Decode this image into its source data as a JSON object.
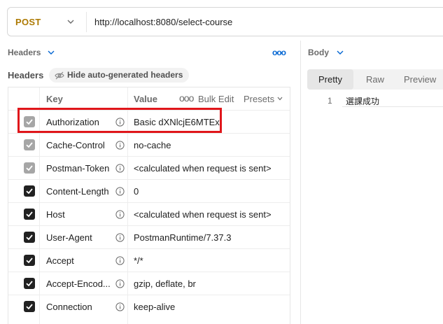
{
  "request": {
    "method": "POST",
    "url": "http://localhost:8080/select-course"
  },
  "left_pane": {
    "section_title": "Headers",
    "more_icon": "ooo",
    "headers_label": "Headers",
    "hide_autogen_label": "Hide auto-generated headers"
  },
  "table": {
    "key_header": "Key",
    "value_header": "Value",
    "more_icon": "ooo",
    "bulk_edit_label": "Bulk Edit",
    "presets_label": "Presets",
    "rows": [
      {
        "key": "Authorization",
        "value": "Basic dXNlcjE6MTEx",
        "checked": true,
        "disabled": true
      },
      {
        "key": "Cache-Control",
        "value": "no-cache",
        "checked": true,
        "disabled": true
      },
      {
        "key": "Postman-Token",
        "value": "<calculated when request is sent>",
        "checked": true,
        "disabled": true
      },
      {
        "key": "Content-Length",
        "value": "0",
        "checked": true,
        "disabled": false
      },
      {
        "key": "Host",
        "value": "<calculated when request is sent>",
        "checked": true,
        "disabled": false
      },
      {
        "key": "User-Agent",
        "value": "PostmanRuntime/7.37.3",
        "checked": true,
        "disabled": false
      },
      {
        "key": "Accept",
        "value": "*/*",
        "checked": true,
        "disabled": false
      },
      {
        "key": "Accept-Encod...",
        "value": "gzip, deflate, br",
        "checked": true,
        "disabled": false
      },
      {
        "key": "Connection",
        "value": "keep-alive",
        "checked": true,
        "disabled": false
      }
    ]
  },
  "right_pane": {
    "body_title": "Body",
    "tabs": [
      "Pretty",
      "Raw",
      "Preview"
    ],
    "active_tab": "Pretty",
    "line_number": "1",
    "response_text": "選課成功"
  },
  "colors": {
    "method": "#ad7a03",
    "highlight": "#e0161b",
    "link": "#0265d2"
  }
}
